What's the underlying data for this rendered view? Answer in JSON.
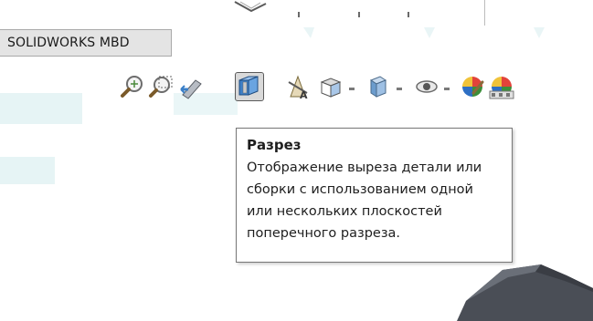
{
  "ribbon": {
    "tab_label": "SOLIDWORKS MBD"
  },
  "toolbar": {
    "icons": [
      {
        "name": "zoom-to-fit-icon"
      },
      {
        "name": "zoom-to-area-icon"
      },
      {
        "name": "previous-view-icon"
      },
      {
        "name": "section-view-icon",
        "active": true
      },
      {
        "name": "dynamic-annotation-views-icon"
      },
      {
        "name": "view-orientation-icon",
        "has_dropdown": true
      },
      {
        "name": "display-style-icon",
        "has_dropdown": true
      },
      {
        "name": "hide-show-items-icon",
        "has_dropdown": true
      },
      {
        "name": "edit-appearance-icon"
      },
      {
        "name": "apply-scene-icon"
      }
    ]
  },
  "tooltip": {
    "title": "Разрез",
    "lines": [
      "Отображение выреза детали или",
      "сборки с использованием одной",
      "или нескольких плоскостей",
      "поперечного разреза."
    ]
  },
  "colors": {
    "tab_bg": "#e4e4e4",
    "tooltip_border": "#767676",
    "model_fill": "#4a4e56",
    "watermark": "#dff0f2"
  }
}
